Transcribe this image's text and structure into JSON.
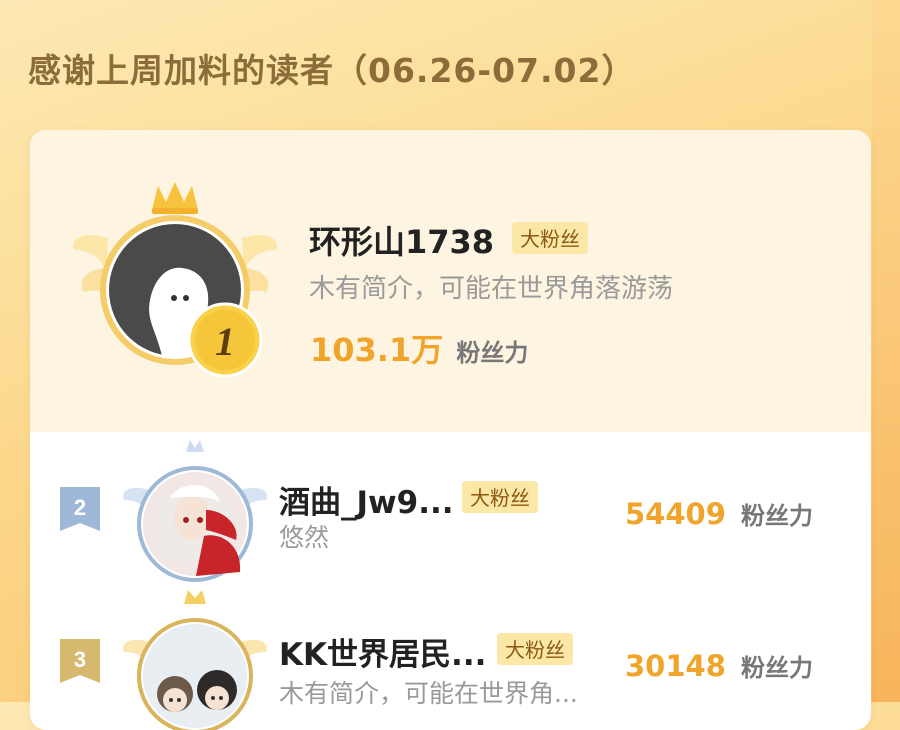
{
  "header": {
    "title": "感谢上周加料的读者（06.26-07.02）"
  },
  "colors": {
    "accent_orange": "#f0a42a",
    "badge_bg": "#fbe7a6",
    "badge_text": "#8a5a10"
  },
  "top_reader": {
    "rank": "1",
    "name": "环形山1738",
    "badge": "大粉丝",
    "bio": "木有简介，可能在世界角落游荡",
    "fans_value": "103.1万",
    "fans_unit": "粉丝力",
    "avatar_icon": "default-ghost-avatar-icon"
  },
  "readers": [
    {
      "rank": "2",
      "name": "酒曲_Jw9...",
      "badge": "大粉丝",
      "bio": "悠然",
      "fans_value": "54409",
      "fans_unit": "粉丝力",
      "avatar_icon": "anime-girl-avatar"
    },
    {
      "rank": "3",
      "name": "KK世界居民...",
      "badge": "大粉丝",
      "bio": "木有简介，可能在世界角...",
      "fans_value": "30148",
      "fans_unit": "粉丝力",
      "avatar_icon": "chibi-couple-avatar"
    }
  ]
}
